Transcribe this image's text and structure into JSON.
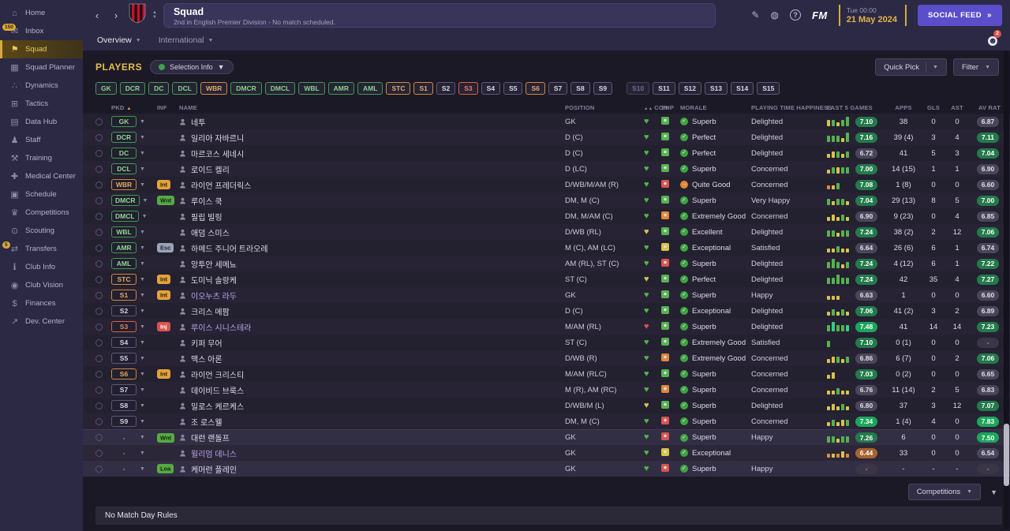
{
  "topbar": {
    "title": "Squad",
    "subtitle": "2nd in English Premier Division - No match scheduled.",
    "date_top": "Tue 00:00",
    "date_main": "21 May 2024",
    "social": "SOCIAL FEED",
    "fm_logo": "FM"
  },
  "subnav": {
    "tab1": "Overview",
    "tab2": "International",
    "avatar_badge": "2"
  },
  "sidebar": {
    "items": [
      {
        "id": "home",
        "label": "Home",
        "glyph": "⌂"
      },
      {
        "id": "inbox",
        "label": "Inbox",
        "glyph": "✉",
        "badge": "150"
      },
      {
        "id": "squad",
        "label": "Squad",
        "glyph": "⚑",
        "selected": true
      },
      {
        "id": "squad-planner",
        "label": "Squad Planner",
        "glyph": "▦"
      },
      {
        "id": "dynamics",
        "label": "Dynamics",
        "glyph": "∴"
      },
      {
        "id": "tactics",
        "label": "Tactics",
        "glyph": "⊞"
      },
      {
        "id": "data-hub",
        "label": "Data Hub",
        "glyph": "▤"
      },
      {
        "id": "staff",
        "label": "Staff",
        "glyph": "♟"
      },
      {
        "id": "training",
        "label": "Training",
        "glyph": "⚒"
      },
      {
        "id": "medical-center",
        "label": "Medical Center",
        "glyph": "✚"
      },
      {
        "id": "schedule",
        "label": "Schedule",
        "glyph": "▣"
      },
      {
        "id": "competitions",
        "label": "Competitions",
        "glyph": "♛"
      },
      {
        "id": "scouting",
        "label": "Scouting",
        "glyph": "⊙"
      },
      {
        "id": "transfers",
        "label": "Transfers",
        "glyph": "⇄",
        "badge": "5"
      },
      {
        "id": "club-info",
        "label": "Club Info",
        "glyph": "ℹ"
      },
      {
        "id": "club-vision",
        "label": "Club Vision",
        "glyph": "◉"
      },
      {
        "id": "finances",
        "label": "Finances",
        "glyph": "$"
      },
      {
        "id": "dev-center",
        "label": "Dev. Center",
        "glyph": "↗"
      }
    ]
  },
  "players_header": {
    "title": "PLAYERS",
    "selection_info": "Selection Info",
    "quick_pick": "Quick Pick",
    "filter": "Filter"
  },
  "chips": [
    {
      "label": "GK",
      "state": "xi"
    },
    {
      "label": "DCR",
      "state": "xi"
    },
    {
      "label": "DC",
      "state": "xi"
    },
    {
      "label": "DCL",
      "state": "xi"
    },
    {
      "label": "WBR",
      "state": "warn"
    },
    {
      "label": "DMCR",
      "state": "xi"
    },
    {
      "label": "DMCL",
      "state": "xi"
    },
    {
      "label": "WBL",
      "state": "xi"
    },
    {
      "label": "AMR",
      "state": "xi"
    },
    {
      "label": "AML",
      "state": "xi"
    },
    {
      "label": "STC",
      "state": "warn"
    },
    {
      "label": "S1",
      "state": "warn"
    },
    {
      "label": "S2",
      "state": "sub"
    },
    {
      "label": "S3",
      "state": "inj"
    },
    {
      "label": "S4",
      "state": "sub"
    },
    {
      "label": "S5",
      "state": "sub"
    },
    {
      "label": "S6",
      "state": "warn"
    },
    {
      "label": "S7",
      "state": "sub"
    },
    {
      "label": "S8",
      "state": "sub"
    },
    {
      "label": "S9",
      "state": "sub"
    },
    {
      "label": "S10",
      "state": "dim",
      "gap": true
    },
    {
      "label": "S11",
      "state": "sub"
    },
    {
      "label": "S12",
      "state": "sub"
    },
    {
      "label": "S13",
      "state": "sub"
    },
    {
      "label": "S14",
      "state": "sub"
    },
    {
      "label": "S15",
      "state": "sub"
    }
  ],
  "table": {
    "columns": {
      "pkd": "PKD",
      "inf": "INF",
      "name": "NAME",
      "position": "POSITION",
      "con": "CON",
      "shp": "SHP",
      "morale": "MORALE",
      "happiness": "PLAYING TIME HAPPINESS",
      "last5": "LAST 5 GAMES",
      "apps": "APPS",
      "gls": "GLS",
      "ast": "AST",
      "avrat": "AV RAT"
    },
    "players": [
      {
        "pkd": "GK",
        "state": "xi",
        "inf": null,
        "name": "네투",
        "link": false,
        "pos": "GK",
        "con": "g",
        "shp": "g",
        "morale": [
          "Superb",
          "g"
        ],
        "happy": "Delighted",
        "bars": [
          "y2",
          "g2",
          "y1",
          "g2",
          "g3"
        ],
        "l5": "7.10",
        "apps": "38",
        "gls": "0",
        "ast": "0",
        "av": "6.87"
      },
      {
        "pkd": "DCR",
        "state": "xi",
        "inf": null,
        "name": "일리아 자바르니",
        "link": false,
        "pos": "D (C)",
        "con": "g",
        "shp": "g",
        "morale": [
          "Perfect",
          "g"
        ],
        "happy": "Delighted",
        "bars": [
          "g2",
          "g2",
          "g2",
          "y1",
          "g3"
        ],
        "l5": "7.16",
        "apps": "39 (4)",
        "gls": "3",
        "ast": "4",
        "av": "7.11"
      },
      {
        "pkd": "DC",
        "state": "xi",
        "inf": null,
        "name": "마르코스 세네시",
        "link": false,
        "pos": "D (C)",
        "con": "g",
        "shp": "g",
        "morale": [
          "Perfect",
          "g"
        ],
        "happy": "Delighted",
        "bars": [
          "y1",
          "y2",
          "g2",
          "y1",
          "g2"
        ],
        "l5": "6.72",
        "apps": "41",
        "gls": "5",
        "ast": "3",
        "av": "7.04"
      },
      {
        "pkd": "DCL",
        "state": "xi",
        "inf": null,
        "name": "로이드 켈리",
        "link": false,
        "pos": "D (LC)",
        "con": "g",
        "shp": "g",
        "morale": [
          "Superb",
          "g"
        ],
        "happy": "Concerned",
        "bars": [
          "y1",
          "g2",
          "y2",
          "g2",
          "g2"
        ],
        "l5": "7.00",
        "apps": "14 (15)",
        "gls": "1",
        "ast": "1",
        "av": "6.90"
      },
      {
        "pkd": "WBR",
        "state": "warn",
        "inf": {
          "t": "Int",
          "c": "int"
        },
        "name": "라이언 프레더릭스",
        "link": false,
        "pos": "D/WB/M/AM (R)",
        "con": "g",
        "shp": "r",
        "morale": [
          "Quite Good",
          "o"
        ],
        "happy": "Concerned",
        "bars": [
          "o1",
          "y1",
          "g2"
        ],
        "l5": "7.08",
        "apps": "1 (8)",
        "gls": "0",
        "ast": "0",
        "av": "6.60"
      },
      {
        "pkd": "DMCR",
        "state": "xi",
        "inf": {
          "t": "Wnt",
          "c": "wnt"
        },
        "name": "루이스 쿡",
        "link": false,
        "pos": "DM, M (C)",
        "con": "g",
        "shp": "g",
        "morale": [
          "Superb",
          "g"
        ],
        "happy": "Very Happy",
        "bars": [
          "g2",
          "y1",
          "g2",
          "g2",
          "y1"
        ],
        "l5": "7.04",
        "apps": "29 (13)",
        "gls": "8",
        "ast": "5",
        "av": "7.00"
      },
      {
        "pkd": "DMCL",
        "state": "xi",
        "inf": null,
        "name": "필립 빌링",
        "link": false,
        "pos": "DM, M/AM (C)",
        "con": "g",
        "shp": "o",
        "morale": [
          "Extremely Good",
          "g"
        ],
        "happy": "Concerned",
        "bars": [
          "y1",
          "y2",
          "y1",
          "g2",
          "y1"
        ],
        "l5": "6.90",
        "apps": "9 (23)",
        "gls": "0",
        "ast": "4",
        "av": "6.85"
      },
      {
        "pkd": "WBL",
        "state": "xi",
        "inf": null,
        "name": "애덤 스미스",
        "link": false,
        "pos": "D/WB (RL)",
        "con": "y",
        "shp": "g",
        "morale": [
          "Excellent",
          "g"
        ],
        "happy": "Delighted",
        "bars": [
          "g2",
          "g2",
          "y1",
          "g2",
          "g2"
        ],
        "l5": "7.24",
        "apps": "38 (2)",
        "gls": "2",
        "ast": "12",
        "av": "7.06"
      },
      {
        "pkd": "AMR",
        "state": "xi",
        "inf": {
          "t": "Esc",
          "c": "esc"
        },
        "name": "하메드 주니어 트라오레",
        "link": false,
        "pos": "M (C), AM (LC)",
        "con": "g",
        "shp": "y",
        "morale": [
          "Exceptional",
          "g"
        ],
        "happy": "Satisfied",
        "bars": [
          "y1",
          "y1",
          "g2",
          "y1",
          "y1"
        ],
        "l5": "6.64",
        "apps": "26 (6)",
        "gls": "6",
        "ast": "1",
        "av": "6.74"
      },
      {
        "pkd": "AML",
        "state": "xi",
        "inf": null,
        "name": "앙투안 세메뇨",
        "link": false,
        "pos": "AM (RL), ST (C)",
        "con": "g",
        "shp": "r",
        "morale": [
          "Superb",
          "g"
        ],
        "happy": "Delighted",
        "bars": [
          "g2",
          "g3",
          "g2",
          "y1",
          "g2"
        ],
        "l5": "7.24",
        "apps": "4 (12)",
        "gls": "6",
        "ast": "1",
        "av": "7.22"
      },
      {
        "pkd": "STC",
        "state": "warn",
        "inf": {
          "t": "Int",
          "c": "int"
        },
        "name": "도미닉 솔랑케",
        "link": false,
        "pos": "ST (C)",
        "con": "y",
        "shp": "g",
        "morale": [
          "Perfect",
          "g"
        ],
        "happy": "Delighted",
        "bars": [
          "g2",
          "g2",
          "g3",
          "g2",
          "g2"
        ],
        "l5": "7.24",
        "apps": "42",
        "gls": "35",
        "ast": "4",
        "av": "7.27"
      },
      {
        "pkd": "S1",
        "state": "warn",
        "inf": {
          "t": "Int",
          "c": "int"
        },
        "name": "이오누츠 라두",
        "link": true,
        "pos": "GK",
        "con": "g",
        "shp": "g",
        "morale": [
          "Superb",
          "g"
        ],
        "happy": "Happy",
        "bars": [
          "y1",
          "y1",
          "y1"
        ],
        "l5": "6.63",
        "apps": "1",
        "gls": "0",
        "ast": "0",
        "av": "6.60"
      },
      {
        "pkd": "S2",
        "state": "sub",
        "inf": null,
        "name": "크리스 메팜",
        "link": false,
        "pos": "D (C)",
        "con": "g",
        "shp": "g",
        "morale": [
          "Exceptional",
          "g"
        ],
        "happy": "Delighted",
        "bars": [
          "y1",
          "g2",
          "y1",
          "g2",
          "y1"
        ],
        "l5": "7.06",
        "apps": "41 (2)",
        "gls": "3",
        "ast": "2",
        "av": "6.89"
      },
      {
        "pkd": "S3",
        "state": "inj",
        "inf": {
          "t": "Inj",
          "c": "inj"
        },
        "name": "루이스 시니스테라",
        "link": true,
        "pos": "M/AM (RL)",
        "con": "r",
        "shp": "g",
        "morale": [
          "Superb",
          "g"
        ],
        "happy": "Delighted",
        "bars": [
          "g2",
          "b3",
          "g2",
          "g2",
          "b2"
        ],
        "l5": "7.48",
        "apps": "41",
        "gls": "14",
        "ast": "14",
        "av": "7.23"
      },
      {
        "pkd": "S4",
        "state": "sub",
        "inf": null,
        "name": "키퍼 무어",
        "link": false,
        "pos": "ST (C)",
        "con": "g",
        "shp": "g",
        "morale": [
          "Extremely Good",
          "g"
        ],
        "happy": "Satisfied",
        "bars": [
          "g2"
        ],
        "l5": "7.10",
        "apps": "0 (1)",
        "gls": "0",
        "ast": "0",
        "av": "-"
      },
      {
        "pkd": "S5",
        "state": "sub",
        "inf": null,
        "name": "맥스 아론",
        "link": false,
        "pos": "D/WB (R)",
        "con": "g",
        "shp": "o",
        "morale": [
          "Extremely Good",
          "g"
        ],
        "happy": "Concerned",
        "bars": [
          "y1",
          "y2",
          "g2",
          "y1",
          "g2"
        ],
        "l5": "6.86",
        "apps": "6 (7)",
        "gls": "0",
        "ast": "2",
        "av": "7.06"
      },
      {
        "pkd": "S6",
        "state": "warn",
        "inf": {
          "t": "Int",
          "c": "int"
        },
        "name": "라이언 크리스티",
        "link": false,
        "pos": "M/AM (RLC)",
        "con": "g",
        "shp": "g",
        "morale": [
          "Superb",
          "g"
        ],
        "happy": "Concerned",
        "bars": [
          "y1",
          "y2"
        ],
        "l5": "7.03",
        "apps": "0 (2)",
        "gls": "0",
        "ast": "0",
        "av": "6.65"
      },
      {
        "pkd": "S7",
        "state": "sub",
        "inf": null,
        "name": "데이비드 브룩스",
        "link": false,
        "pos": "M (R), AM (RC)",
        "con": "g",
        "shp": "o",
        "morale": [
          "Superb",
          "g"
        ],
        "happy": "Concerned",
        "bars": [
          "y1",
          "y1",
          "g2",
          "y1",
          "y1"
        ],
        "l5": "6.76",
        "apps": "11 (14)",
        "gls": "2",
        "ast": "5",
        "av": "6.83"
      },
      {
        "pkd": "S8",
        "state": "sub",
        "inf": null,
        "name": "밀로스 케르케스",
        "link": false,
        "pos": "D/WB/M (L)",
        "con": "y",
        "shp": "g",
        "morale": [
          "Superb",
          "g"
        ],
        "happy": "Delighted",
        "bars": [
          "y1",
          "y2",
          "y1",
          "g2",
          "y1"
        ],
        "l5": "6.80",
        "apps": "37",
        "gls": "3",
        "ast": "12",
        "av": "7.07"
      },
      {
        "pkd": "S9",
        "state": "sub",
        "inf": null,
        "name": "조 로스웰",
        "link": false,
        "pos": "DM, M (C)",
        "con": "g",
        "shp": "r",
        "morale": [
          "Superb",
          "g"
        ],
        "happy": "Concerned",
        "bars": [
          "y1",
          "g2",
          "y1",
          "y2",
          "g2"
        ],
        "l5": "7.34",
        "apps": "1 (4)",
        "gls": "4",
        "ast": "0",
        "av": "7.83"
      },
      {
        "pkd": "-",
        "state": "none",
        "inf": {
          "t": "Wnt",
          "c": "wnt"
        },
        "name": "대런 랜돌프",
        "link": false,
        "pos": "GK",
        "con": "g",
        "shp": "r",
        "morale": [
          "Superb",
          "g"
        ],
        "happy": "Happy",
        "bars": [
          "g2",
          "g2",
          "y1",
          "g2",
          "g2"
        ],
        "l5": "7.26",
        "apps": "6",
        "gls": "0",
        "ast": "0",
        "av": "7.50"
      },
      {
        "pkd": "-",
        "state": "none",
        "inf": null,
        "name": "윌리엄 데니스",
        "link": true,
        "pos": "GK",
        "con": "g",
        "shp": "y",
        "morale": [
          "Exceptional",
          "g"
        ],
        "happy": "",
        "bars": [
          "o1",
          "y1",
          "o1",
          "y2",
          "o1"
        ],
        "l5": "6.44",
        "apps": "33",
        "gls": "0",
        "ast": "0",
        "av": "6.54"
      },
      {
        "pkd": "-",
        "state": "none",
        "inf": {
          "t": "Loa",
          "c": "loa"
        },
        "name": "케머런 플레인",
        "link": false,
        "pos": "GK",
        "con": "g",
        "shp": "r",
        "morale": [
          "Superb",
          "g"
        ],
        "happy": "Happy",
        "bars": [],
        "l5": "-",
        "apps": "-",
        "gls": "-",
        "ast": "-",
        "av": "-"
      }
    ]
  },
  "footer": {
    "competitions": "Competitions",
    "no_match": "No Match Day Rules"
  }
}
